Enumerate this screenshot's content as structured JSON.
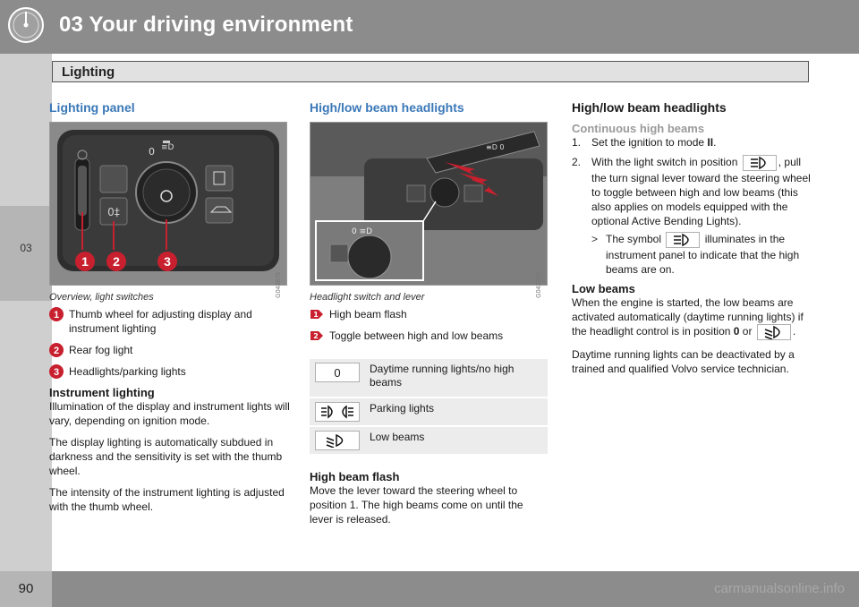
{
  "header": {
    "chapter_title": "03 Your driving environment"
  },
  "sidebar": {
    "chapter_tab": "03"
  },
  "section": {
    "title": "Lighting"
  },
  "footer": {
    "page_number": "90",
    "watermark": "carmanualsonline.info"
  },
  "col1": {
    "heading": "Lighting panel",
    "figure_code": "G043875",
    "callouts": [
      "1",
      "2",
      "3"
    ],
    "caption": "Overview, light switches",
    "legend": [
      {
        "num": "1",
        "text": "Thumb wheel for adjusting display and instrument lighting"
      },
      {
        "num": "2",
        "text": "Rear fog light"
      },
      {
        "num": "3",
        "text": "Headlights/parking lights"
      }
    ],
    "sub_heading": "Instrument lighting",
    "paragraphs": [
      "Illumination of the display and instrument lights will vary, depending on ignition mode.",
      "The display lighting is automatically subdued in darkness and the sensitivity is set with the thumb wheel.",
      "The intensity of the instrument lighting is adjusted with the thumb wheel."
    ]
  },
  "col2": {
    "heading": "High/low beam headlights",
    "figure_code": "G043785",
    "caption": "Headlight switch and lever",
    "legend": [
      {
        "num": "1",
        "text": "High beam flash"
      },
      {
        "num": "2",
        "text": "Toggle between high and low beams"
      }
    ],
    "table": [
      {
        "symbol": "0",
        "icon": "zero-position",
        "text": "Daytime running lights/no high beams"
      },
      {
        "symbol": "",
        "icon": "parking-lights-icon",
        "text": "Parking lights"
      },
      {
        "symbol": "",
        "icon": "low-beam-icon",
        "text": "Low beams"
      }
    ],
    "sub_heading": "High beam flash",
    "paragraph": "Move the lever toward the steering wheel to position 1. The high beams come on until the lever is released."
  },
  "col3": {
    "heading": "High/low beam headlights",
    "sub_heading": "Continuous high beams",
    "step1_num": "1.",
    "step1_pre": "Set the ignition to mode ",
    "step1_bold": "II",
    "step1_post": ".",
    "step2_num": "2.",
    "step2_pre": "With the light switch in position",
    "step2_post": ", pull the turn signal lever toward the steering wheel to toggle between high and low beams (this also applies on models equipped with the optional Active Bending Lights).",
    "result_marker": ">",
    "result_pre": "The symbol",
    "result_post": "illuminates in the instrument panel to indicate that the high beams are on.",
    "low_heading": "Low beams",
    "low_pre": "When the engine is started, the low beams are activated automatically (daytime running lights) if the headlight control is in position ",
    "low_bold": "0",
    "low_mid": " or",
    "low_end": ".",
    "paragraph2": "Daytime running lights can be deactivated by a trained and qualified Volvo service technician."
  },
  "colors": {
    "accent_blue": "#3a78b8",
    "callout_red": "#c8202e",
    "header_gray": "#8c8c8c"
  }
}
